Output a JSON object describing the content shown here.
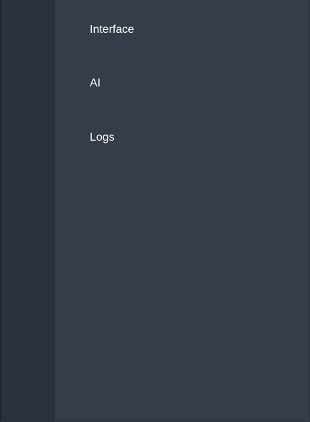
{
  "menu": {
    "items": [
      {
        "label": "Interface"
      },
      {
        "label": "AI"
      },
      {
        "label": "Logs"
      }
    ]
  },
  "colors": {
    "rail": "#2a333c",
    "panel": "#343d49",
    "text": "#ffffff"
  }
}
